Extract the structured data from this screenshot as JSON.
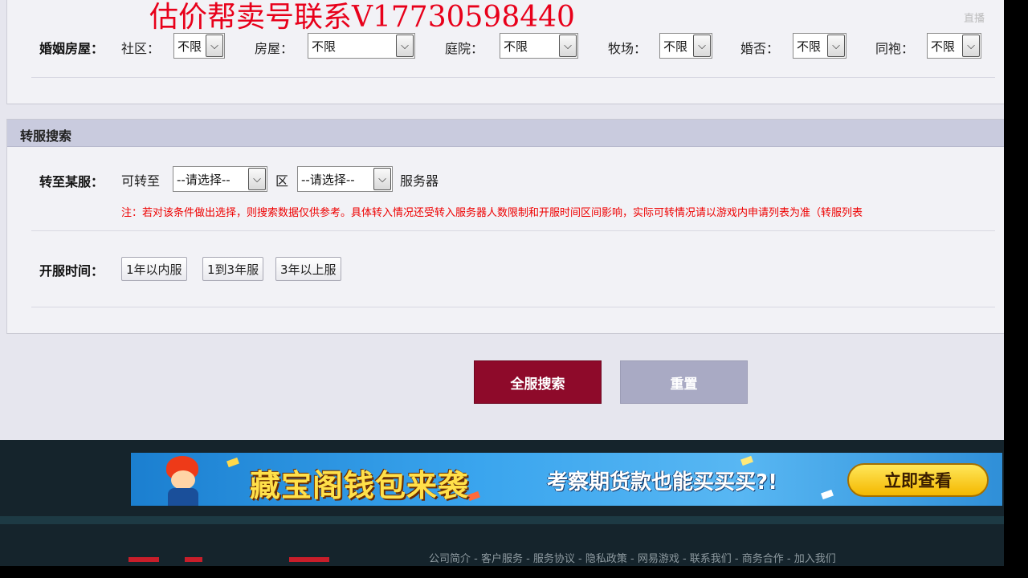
{
  "watermark": "估价帮卖号联系V17730598440",
  "live_badge": "直播",
  "marriage": {
    "label": "婚姻房屋：",
    "fields": [
      {
        "label": "社区：",
        "value": "不限"
      },
      {
        "label": "房屋：",
        "value": "不限"
      },
      {
        "label": "庭院：",
        "value": "不限"
      },
      {
        "label": "牧场：",
        "value": "不限"
      },
      {
        "label": "婚否：",
        "value": "不限"
      },
      {
        "label": "同袍：",
        "value": "不限"
      }
    ]
  },
  "transfer": {
    "section_title": "转服搜索",
    "row_label": "转至某服：",
    "prefix": "可转至",
    "select1": "--请选择--",
    "zone_word": "区",
    "select2": "--请选择--",
    "server_word": "服务器",
    "note": "注：若对该条件做出选择，则搜索数据仅供参考。具体转入情况还受转入服务器人数限制和开服时间区间影响，实际可转情况请以游戏内申请列表为准（转服列表"
  },
  "open_time": {
    "label": "开服时间：",
    "options": [
      "1年以内服",
      "1到3年服",
      "3年以上服"
    ]
  },
  "actions": {
    "search": "全服搜索",
    "reset": "重置"
  },
  "banner": {
    "title": "藏宝阁钱包来袭",
    "subtitle": "考察期货款也能买买买?!",
    "cta": "立即查看"
  },
  "footer": {
    "links": "公司简介 - 客户服务 - 服务协议 - 隐私政策 - 网易游戏 - 联系我们 - 商务合作 - 加入我们"
  },
  "colors": {
    "primary_button": "#8e0a2a",
    "secondary_button": "#a9aac4",
    "note_text": "#e00000",
    "watermark": "#e8001a"
  }
}
